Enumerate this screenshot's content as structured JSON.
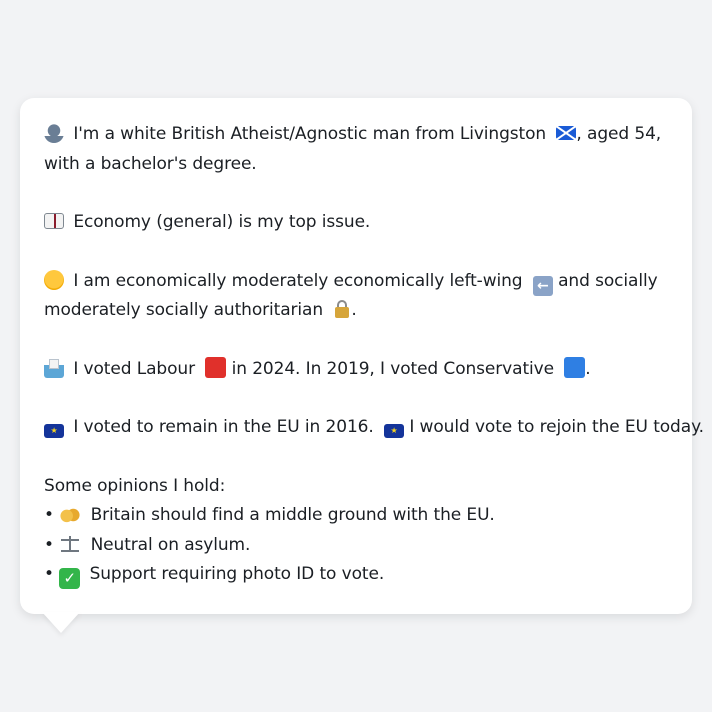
{
  "profile": {
    "identity": {
      "person_icon": "person-icon",
      "text_1": "I'm a white British Atheist/Agnostic man from Livingston",
      "flag_icon": "scotland-flag-icon",
      "text_2": ", aged 54,",
      "text_3": "with a bachelor's degree."
    },
    "issue": {
      "icon": "book-icon",
      "text": "Economy (general) is my top issue."
    },
    "ideology": {
      "icon": "thinking-face-icon",
      "text_1": "I am economically moderately economically left-wing",
      "left_icon": "left-arrow-icon",
      "text_2": "and socially",
      "text_3": "moderately socially authoritarian",
      "lock_icon": "lock-icon",
      "text_4": "."
    },
    "votes": {
      "icon": "ballot-box-icon",
      "text_1": "I voted Labour",
      "labour_icon": "red-square-icon",
      "text_2": "in 2024. In 2019, I voted Conservative",
      "conservative_icon": "blue-square-icon",
      "text_3": "."
    },
    "eu": {
      "icon": "eu-flag-icon",
      "text_1": "I voted to remain in the EU in 2016.",
      "icon_2": "eu-flag-icon",
      "text_2": "I would vote to rejoin the EU today."
    },
    "opinions": {
      "heading": "Some opinions I hold:",
      "items": [
        {
          "bullet": "•",
          "icon": "handshake-icon",
          "text": "Britain should find a middle ground with the EU."
        },
        {
          "bullet": "•",
          "icon": "scales-icon",
          "text": "Neutral on asylum."
        },
        {
          "bullet": "•",
          "icon": "check-mark-icon",
          "text": "Support requiring photo ID to vote."
        }
      ]
    }
  },
  "colors": {
    "background": "#f2f3f5",
    "card": "#ffffff",
    "text": "#1b1f24",
    "labour_red": "#e0302b",
    "conservative_blue": "#2f7fe3",
    "check_green": "#33b54a"
  }
}
